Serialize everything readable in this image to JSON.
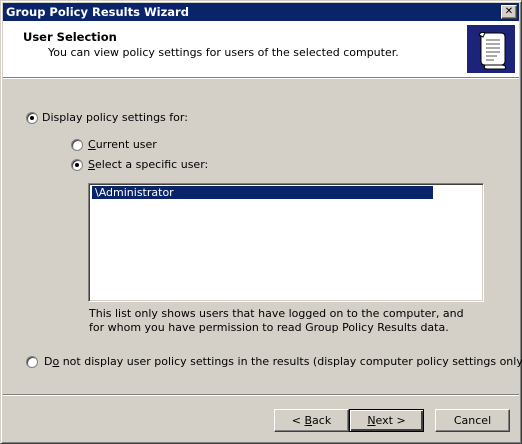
{
  "window": {
    "title": "Group Policy Results Wizard",
    "close_glyph": "✕"
  },
  "header": {
    "title": "User Selection",
    "subtitle": "You can view policy settings for users of the selected computer.",
    "icon": "scroll-icon"
  },
  "options": {
    "display_settings": {
      "label": "Display policy settings for:",
      "checked": true
    },
    "current_user": {
      "label_u": "C",
      "label_rest": "urrent user",
      "checked": false
    },
    "specific_user": {
      "label_u": "S",
      "label_rest": "elect a specific user:",
      "checked": true
    },
    "do_not_display": {
      "label_pre": "D",
      "label_u": "o",
      "label_rest": " not display user policy settings in the results (display computer policy settings only)",
      "checked": false
    }
  },
  "user_list": {
    "items": [
      "\\Administrator"
    ],
    "selected_index": 0
  },
  "note": "This list only shows users that have logged on to the computer, and for whom you have permission to read Group Policy Results data.",
  "buttons": {
    "back": {
      "prefix": "< ",
      "u": "B",
      "rest": "ack"
    },
    "next": {
      "u": "N",
      "rest": "ext >"
    },
    "cancel": {
      "label": "Cancel"
    }
  }
}
